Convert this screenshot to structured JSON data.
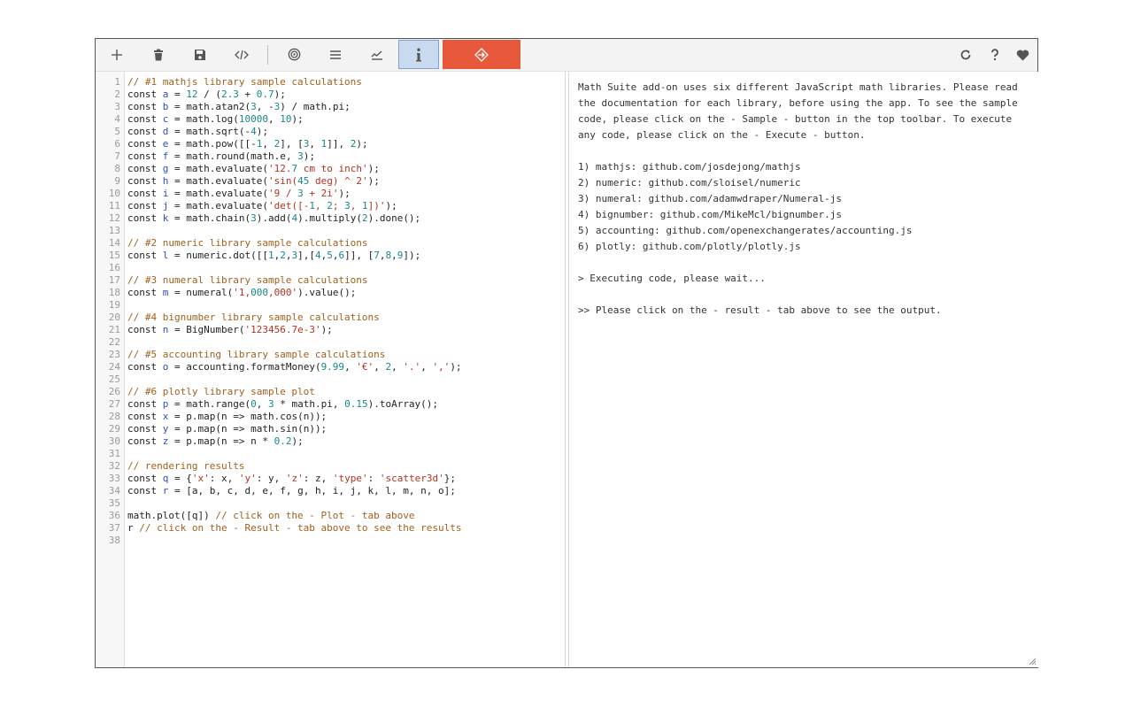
{
  "toolbar": {
    "left_icons": [
      "plus-icon",
      "trash-icon",
      "save-icon",
      "code-icon",
      "target-icon",
      "menu-icon",
      "chart-icon",
      "info-icon",
      "execute-icon"
    ],
    "right_icons": [
      "refresh-icon",
      "help-icon",
      "heart-icon"
    ],
    "colors": {
      "execute_bg": "#e8583a",
      "active_bg": "#c9d9ee"
    }
  },
  "editor": {
    "lines": [
      "// #1 mathjs library sample calculations",
      "const a = 12 / (2.3 + 0.7);",
      "const b = math.atan2(3, -3) / math.pi;",
      "const c = math.log(10000, 10);",
      "const d = math.sqrt(-4);",
      "const e = math.pow([[-1, 2], [3, 1]], 2);",
      "const f = math.round(math.e, 3);",
      "const g = math.evaluate('12.7 cm to inch');",
      "const h = math.evaluate('sin(45 deg) ^ 2');",
      "const i = math.evaluate('9 / 3 + 2i');",
      "const j = math.evaluate('det([-1, 2; 3, 1])');",
      "const k = math.chain(3).add(4).multiply(2).done();",
      "",
      "// #2 numeric library sample calculations",
      "const l = numeric.dot([[1,2,3],[4,5,6]], [7,8,9]);",
      "",
      "// #3 numeral library sample calculations",
      "const m = numeral('1,000,000').value();",
      "",
      "// #4 bignumber library sample calculations",
      "const n = BigNumber('123456.7e-3');",
      "",
      "// #5 accounting library sample calculations",
      "const o = accounting.formatMoney(9.99, '€', 2, '.', ',');",
      "",
      "// #6 plotly library sample plot",
      "const p = math.range(0, 3 * math.pi, 0.15).toArray();",
      "const x = p.map(n => math.cos(n));",
      "const y = p.map(n => math.sin(n));",
      "const z = p.map(n => n * 0.2);",
      "",
      "// rendering results",
      "const q = {'x': x, 'y': y, 'z': z, 'type': 'scatter3d'};",
      "const r = [a, b, c, d, e, f, g, h, i, j, k, l, m, n, o];",
      "",
      "math.plot([q]) // click on the - Plot - tab above",
      "r // click on the - Result - tab above to see the results",
      ""
    ]
  },
  "output": {
    "lines": [
      "Math Suite add-on uses six different JavaScript math libraries. Please read",
      "the documentation for each library, before using the app. To see the sample",
      "code, please click on the - Sample - button in the top toolbar. To execute",
      "any code, please click on the - Execute - button.",
      "",
      "1) mathjs: github.com/josdejong/mathjs",
      "2) numeric: github.com/sloisel/numeric",
      "3) numeral: github.com/adamwdraper/Numeral-js",
      "4) bignumber: github.com/MikeMcl/bignumber.js",
      "5) accounting: github.com/openexchangerates/accounting.js",
      "6) plotly: github.com/plotly/plotly.js",
      "",
      "> Executing code, please wait...",
      "",
      ">> Please click on the - result - tab above to see the output."
    ]
  }
}
